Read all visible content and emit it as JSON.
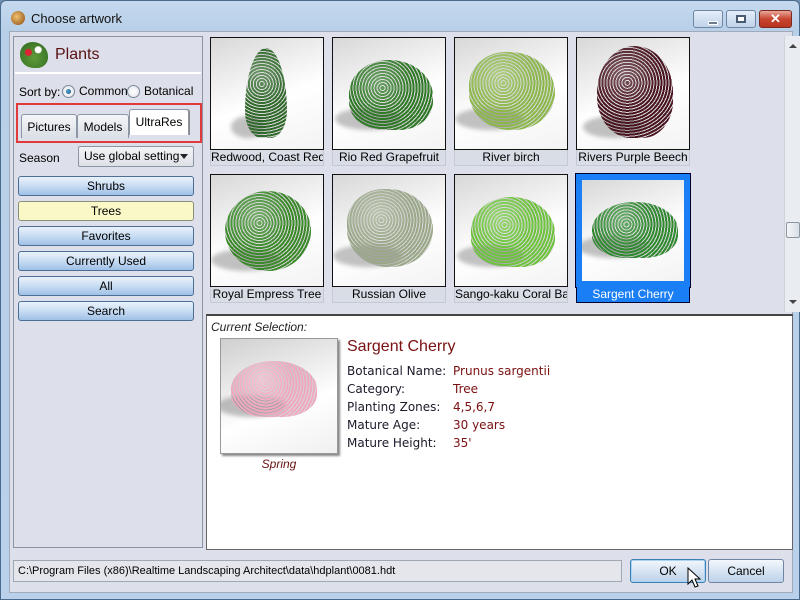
{
  "window": {
    "title": "Choose artwork",
    "controls": {
      "minimize": "minimize",
      "maximize": "maximize",
      "close": "✕"
    }
  },
  "library": {
    "title": "Plants",
    "sort_by_label": "Sort by:",
    "sort_options": [
      {
        "label": "Common",
        "checked": true
      },
      {
        "label": "Botanical",
        "checked": false
      }
    ],
    "tabs": [
      {
        "label": "Pictures",
        "active": false
      },
      {
        "label": "Models",
        "active": false
      },
      {
        "label": "UltraRes",
        "active": true
      }
    ],
    "season_label": "Season",
    "season_value": "Use global setting",
    "categories": [
      {
        "label": "Shrubs",
        "active": false
      },
      {
        "label": "Trees",
        "active": true
      },
      {
        "label": "Favorites",
        "active": false
      },
      {
        "label": "Currently Used",
        "active": false
      },
      {
        "label": "All",
        "active": false
      },
      {
        "label": "Search",
        "active": false
      }
    ]
  },
  "gallery": {
    "items": [
      {
        "label": "Redwood, Coast Red...",
        "selected": false,
        "foliage": "#2f6a2a",
        "shape": "cone"
      },
      {
        "label": "Rio Red Grapefruit",
        "selected": false,
        "foliage": "#2f7a26",
        "shape": "bush"
      },
      {
        "label": "River birch",
        "selected": false,
        "foliage": "#8cb84a",
        "shape": "airy"
      },
      {
        "label": "Rivers Purple Beech",
        "selected": false,
        "foliage": "#4a1420",
        "shape": "tall"
      },
      {
        "label": "Royal Empress Tree",
        "selected": false,
        "foliage": "#3a8a2a",
        "shape": "round"
      },
      {
        "label": "Russian Olive",
        "selected": false,
        "foliage": "#9aa888",
        "shape": "airy"
      },
      {
        "label": "Sango-kaku Coral Ba...",
        "selected": false,
        "foliage": "#6cc43a",
        "shape": "bush"
      },
      {
        "label": "Sargent Cherry",
        "selected": true,
        "foliage": "#2f8a30",
        "shape": "wide"
      }
    ]
  },
  "selection": {
    "heading": "Current Selection:",
    "name": "Sargent Cherry",
    "season_caption": "Spring",
    "preview_foliage": "#f0a8c0",
    "attributes": [
      {
        "key": "Botanical Name:",
        "value": "Prunus sargentii"
      },
      {
        "key": "Category:",
        "value": "Tree"
      },
      {
        "key": "Planting Zones:",
        "value": "4,5,6,7"
      },
      {
        "key": "Mature Age:",
        "value": "30 years"
      },
      {
        "key": "Mature Height:",
        "value": "35'"
      }
    ]
  },
  "footer": {
    "path": "C:\\Program Files (x86)\\Realtime Landscaping Architect\\data\\hdplant\\0081.hdt",
    "ok_label": "OK",
    "cancel_label": "Cancel"
  }
}
